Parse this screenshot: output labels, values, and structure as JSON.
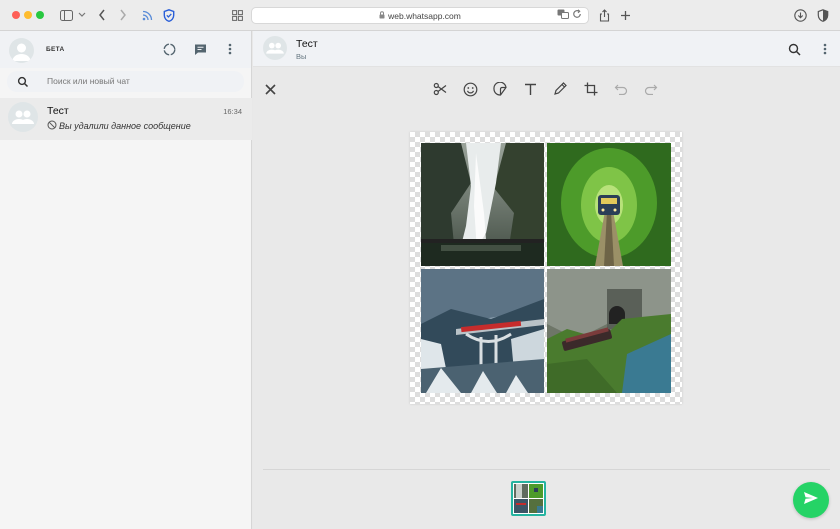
{
  "browser": {
    "url": "web.whatsapp.com"
  },
  "sidebar": {
    "profile_label": "БЕТА",
    "search_placeholder": "Поиск или новый чат",
    "chats": [
      {
        "name": "Тест",
        "time": "16:34",
        "last_message": "Вы удалили данное сообщение"
      }
    ]
  },
  "conversation": {
    "title": "Тест",
    "subtitle": "Вы"
  },
  "editor": {
    "tools": [
      "scissors-icon",
      "emoji-icon",
      "sticker-icon",
      "text-icon",
      "pencil-icon",
      "crop-icon",
      "undo-icon",
      "redo-icon"
    ],
    "images": [
      "waterfall-photo",
      "tree-tunnel-train-photo",
      "snow-bridge-train-photo",
      "mountain-tunnel-train-photo"
    ]
  },
  "colors": {
    "send_button": "#25d366",
    "thumb_border": "#25b4a0"
  }
}
